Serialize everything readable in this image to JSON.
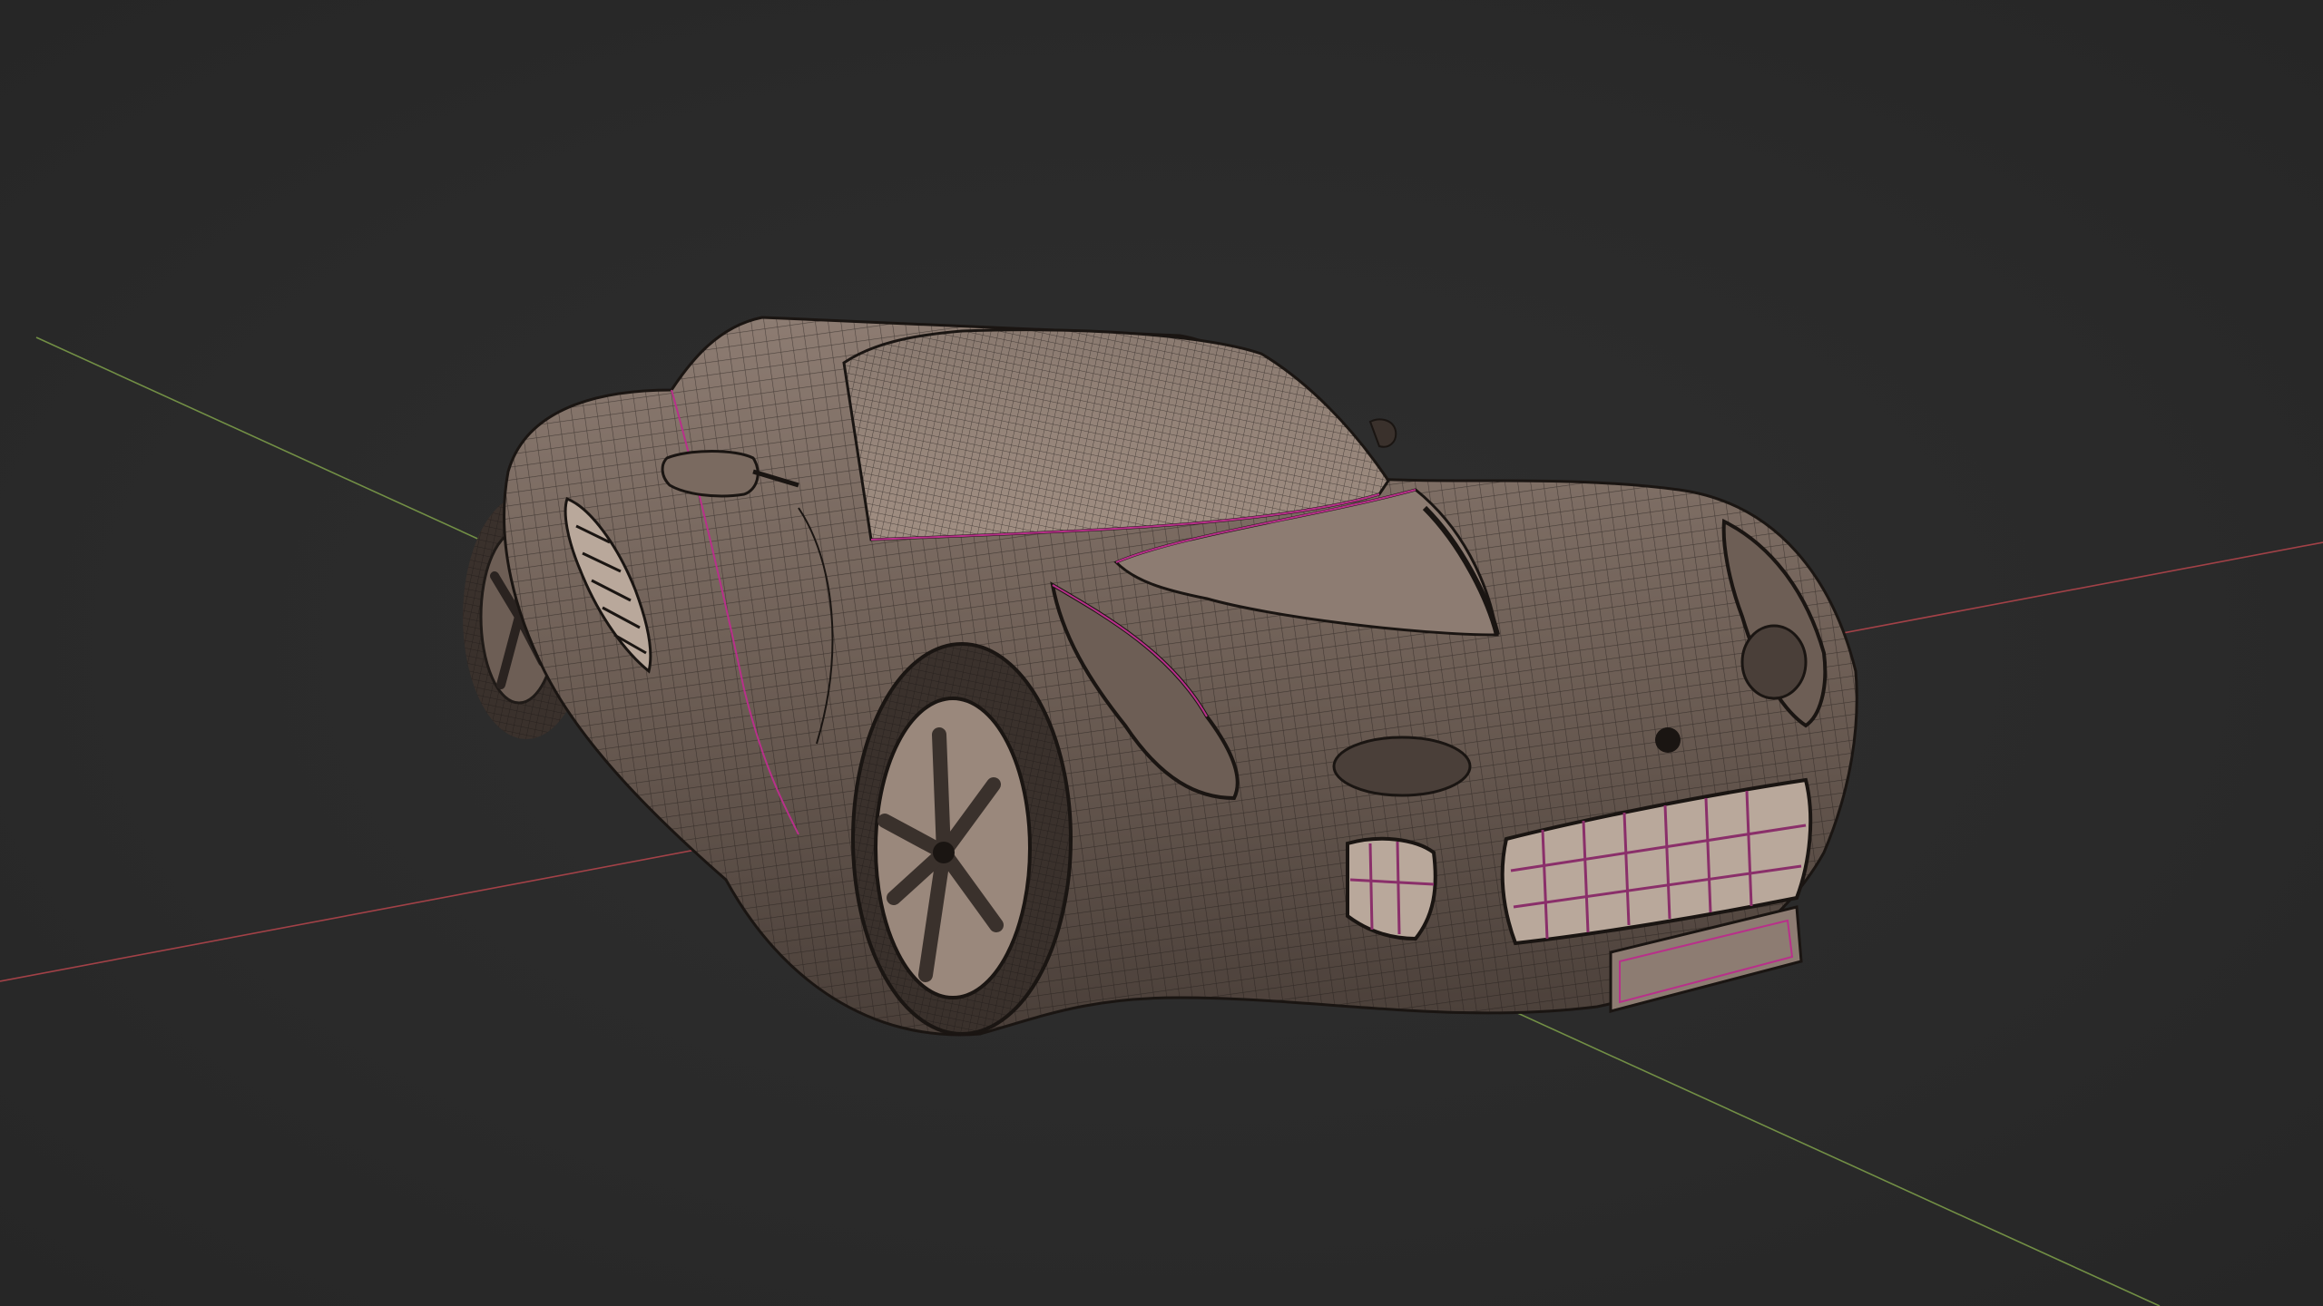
{
  "viewport": {
    "background_color": "#2b2b2b",
    "shading_mode": "wireframe-overlay",
    "axes": {
      "x_axis_color": "#b8464d",
      "y_axis_color": "#7fa14a"
    },
    "object": {
      "type": "car",
      "mesh_color": "#7a6a60",
      "wire_color": "#1f1a17",
      "seam_color": "#b8308a"
    }
  }
}
